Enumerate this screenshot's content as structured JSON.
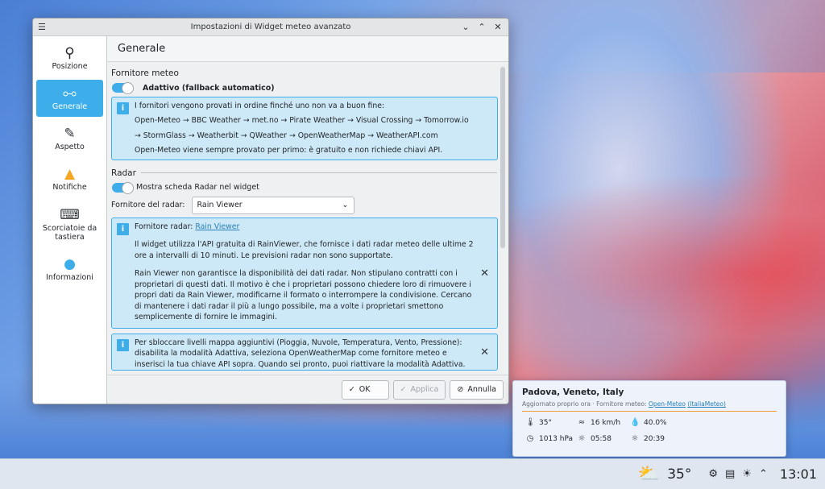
{
  "window": {
    "title": "Impostazioni di Widget meteo avanzato",
    "controls": {
      "minimize": "⌄",
      "maximize": "⌃",
      "close": "✕"
    }
  },
  "sidebar": {
    "items": [
      {
        "label": "Posizione",
        "icon": "location-pin-icon",
        "glyph": "📍"
      },
      {
        "label": "Generale",
        "icon": "sliders-icon",
        "glyph": "⚙"
      },
      {
        "label": "Aspetto",
        "icon": "paintbrush-icon",
        "glyph": "✎"
      },
      {
        "label": "Notifiche",
        "icon": "bell-icon",
        "glyph": "🔔"
      },
      {
        "label": "Scorciatoie da tastiera",
        "icon": "keyboard-icon",
        "glyph": "⌨"
      },
      {
        "label": "Informazioni",
        "icon": "info-icon",
        "glyph": "ℹ"
      }
    ]
  },
  "page": {
    "title": "Generale",
    "provider_section": "Fornitore meteo",
    "adaptive_toggle": "Adattivo (fallback automatico)",
    "provider_info": {
      "line1": "I fornitori vengono provati in ordine finché uno non va a buon fine:",
      "chain1": "Open-Meteo → BBC Weather → met.no → Pirate Weather → Visual Crossing → Tomorrow.io",
      "chain2": "→ StormGlass → Weatherbit → QWeather → OpenWeatherMap → WeatherAPI.com",
      "line2": "Open-Meteo viene sempre provato per primo: è gratuito e non richiede chiavi API."
    },
    "radar_section": "Radar",
    "radar_toggle": "Mostra scheda Radar nel widget",
    "radar_provider_label": "Fornitore del radar:",
    "radar_provider_value": "Rain Viewer",
    "radar_info": {
      "prefix": "Fornitore radar: ",
      "link": "Rain Viewer",
      "para1": "Il widget utilizza l'API gratuita di RainViewer, che fornisce i dati radar meteo delle ultime 2 ore a intervalli di 10 minuti. Le previsioni radar non sono supportate.",
      "para2": "Rain Viewer non garantisce la disponibilità dei dati radar. Non stipulano contratti con i proprietari di questi dati. Il motivo è che i proprietari possono chiedere loro di rimuovere i propri dati da Rain Viewer, modificarne il formato o interrompere la condivisione. Cercano di mantenere i dati radar il più a lungo possibile, ma a volte i proprietari smettono semplicemente di fornire le immagini."
    },
    "unlock_info": "Per sbloccare livelli mappa aggiuntivi (Pioggia, Nuvole, Temperatura, Vento, Pressione): disabilita la modalità Adattiva, seleziona OpenWeatherMap come fornitore meteo e inserisci la tua chiave API sopra. Quando sei pronto, puoi riattivare la modalità Adattiva."
  },
  "buttons": {
    "ok": "OK",
    "apply": "Applica",
    "cancel": "Annulla"
  },
  "popup": {
    "location": "Padova, Veneto, Italy",
    "updated_prefix": "Aggiornato proprio ora · Fornitore meteo: ",
    "provider_link": "Open-Meteo",
    "provider_paren": "(ItaliaMeteo)",
    "temperature": "35°",
    "wind": "16 km/h",
    "humidity": "40.0%",
    "pressure": "1013 hPa",
    "sunrise": "05:58",
    "sunset": "20:39"
  },
  "taskbar": {
    "temp": "35°",
    "clock": "13:01"
  }
}
